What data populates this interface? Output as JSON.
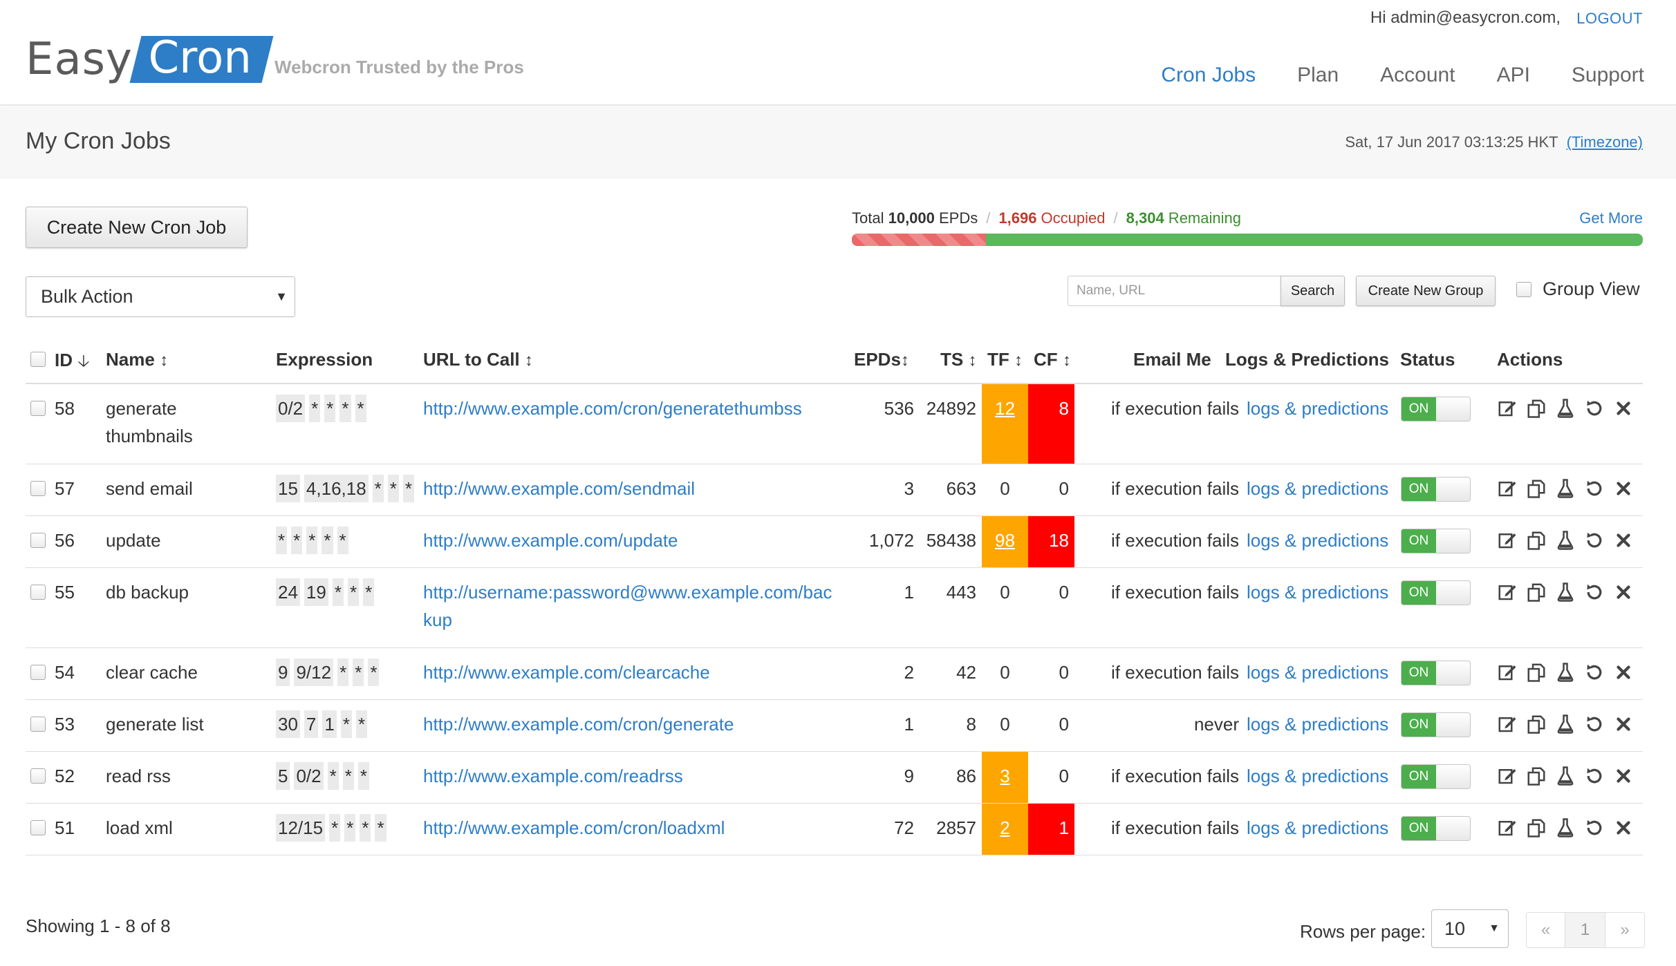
{
  "brand": {
    "logo_easy": "Easy",
    "logo_cron": "Cron",
    "tagline": "Webcron Trusted by the Pros"
  },
  "header": {
    "greeting": "Hi admin@easycron.com,",
    "logout": "LOGOUT",
    "nav": [
      "Cron Jobs",
      "Plan",
      "Account",
      "API",
      "Support"
    ],
    "active_nav": "Cron Jobs"
  },
  "page": {
    "title": "My Cron Jobs",
    "datetime": "Sat, 17 Jun 2017 03:13:25 HKT",
    "timezone_link": "(Timezone)"
  },
  "toolbar": {
    "create_job": "Create New Cron Job",
    "bulk_action": "Bulk Action",
    "search_placeholder": "Name, URL",
    "search_button": "Search",
    "create_group": "Create New Group",
    "group_view": "Group View"
  },
  "epd": {
    "total_prefix": "Total ",
    "total": "10,000",
    "total_suffix": " EPDs",
    "occupied": "1,696",
    "occupied_label": " Occupied",
    "remaining": "8,304",
    "remaining_label": " Remaining",
    "get_more": "Get More",
    "occupied_fraction": 0.1696
  },
  "table": {
    "headers": {
      "id": "ID",
      "name": "Name",
      "expression": "Expression",
      "url": "URL to Call",
      "epds": "EPDs",
      "ts": "TS",
      "tf": "TF",
      "cf": "CF",
      "email": "Email Me",
      "logs": "Logs & Predictions",
      "status": "Status",
      "actions": "Actions"
    },
    "rows": [
      {
        "id": "58",
        "name": "generate thumbnails",
        "expr": [
          "0/2",
          "*",
          "*",
          "*",
          "*"
        ],
        "url": "http://www.example.com/cron/generatethumbss",
        "epds": "536",
        "ts": "24892",
        "tf": "12",
        "cf": "8",
        "email": "if execution fails",
        "logs": "logs & predictions",
        "status": "ON"
      },
      {
        "id": "57",
        "name": "send email",
        "expr": [
          "15",
          "4,16,18",
          "*",
          "*",
          "*"
        ],
        "url": "http://www.example.com/sendmail",
        "epds": "3",
        "ts": "663",
        "tf": "0",
        "cf": "0",
        "email": "if execution fails",
        "logs": "logs & predictions",
        "status": "ON"
      },
      {
        "id": "56",
        "name": "update",
        "expr": [
          "*",
          "*",
          "*",
          "*",
          "*"
        ],
        "url": "http://www.example.com/update",
        "epds": "1,072",
        "ts": "58438",
        "tf": "98",
        "cf": "18",
        "email": "if execution fails",
        "logs": "logs & predictions",
        "status": "ON"
      },
      {
        "id": "55",
        "name": "db backup",
        "expr": [
          "24",
          "19",
          "*",
          "*",
          "*"
        ],
        "url": "http://username:password@www.example.com/backup",
        "epds": "1",
        "ts": "443",
        "tf": "0",
        "cf": "0",
        "email": "if execution fails",
        "logs": "logs & predictions",
        "status": "ON"
      },
      {
        "id": "54",
        "name": "clear cache",
        "expr": [
          "9",
          "9/12",
          "*",
          "*",
          "*"
        ],
        "url": "http://www.example.com/clearcache",
        "epds": "2",
        "ts": "42",
        "tf": "0",
        "cf": "0",
        "email": "if execution fails",
        "logs": "logs & predictions",
        "status": "ON"
      },
      {
        "id": "53",
        "name": "generate list",
        "expr": [
          "30",
          "7",
          "1",
          "*",
          "*"
        ],
        "url": "http://www.example.com/cron/generate",
        "epds": "1",
        "ts": "8",
        "tf": "0",
        "cf": "0",
        "email": "never",
        "logs": "logs & predictions",
        "status": "ON"
      },
      {
        "id": "52",
        "name": "read rss",
        "expr": [
          "5",
          "0/2",
          "*",
          "*",
          "*"
        ],
        "url": "http://www.example.com/readrss",
        "epds": "9",
        "ts": "86",
        "tf": "3",
        "cf": "0",
        "email": "if execution fails",
        "logs": "logs & predictions",
        "status": "ON"
      },
      {
        "id": "51",
        "name": "load xml",
        "expr": [
          "12/15",
          "*",
          "*",
          "*",
          "*"
        ],
        "url": "http://www.example.com/cron/loadxml",
        "epds": "72",
        "ts": "2857",
        "tf": "2",
        "cf": "1",
        "email": "if execution fails",
        "logs": "logs & predictions",
        "status": "ON"
      }
    ]
  },
  "footer": {
    "showing": "Showing 1 - 8 of 8",
    "rows_per_page_label": "Rows per page:",
    "rows_per_page": "10",
    "pager": [
      "«",
      "1",
      "»"
    ]
  },
  "colors": {
    "accent": "#2e7dc7",
    "tf_highlight": "#ffa500",
    "cf_highlight": "#ff0000",
    "toggle_on": "#4cae4c",
    "occupied": "#c0392b",
    "remaining": "#3b8f2e"
  },
  "icons": {
    "row_actions": [
      "edit-icon",
      "copy-icon",
      "test-flask-icon",
      "reset-icon",
      "delete-icon"
    ],
    "sort": "sort-arrows-icon"
  }
}
